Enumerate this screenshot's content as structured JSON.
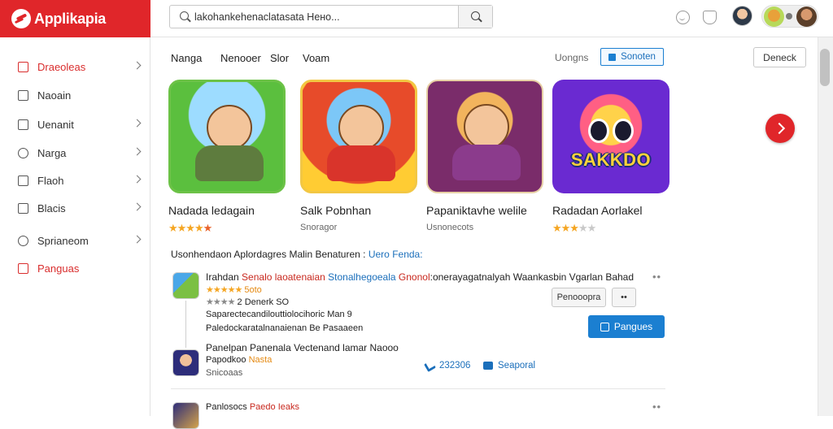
{
  "brand": {
    "name": "Applikapia"
  },
  "search": {
    "value": "lakohankehenaclatasata Hено..."
  },
  "sidebar": {
    "items": [
      {
        "label": "Draeoleas"
      },
      {
        "label": "Naoain"
      },
      {
        "label": "Uenanit"
      },
      {
        "label": "Narga"
      },
      {
        "label": "Flaoh"
      },
      {
        "label": "Blacis"
      },
      {
        "label": "Sprianeom"
      },
      {
        "label": "Panguas"
      }
    ]
  },
  "filters": {
    "tabs": [
      "Nanga",
      "Nenooer",
      "Slor",
      "Voam"
    ],
    "link": "Uongns",
    "highlight_button": "Sonoten",
    "right_button": "Deneck"
  },
  "cards": [
    {
      "title": "Nadada ledagain",
      "stars": "★★★★",
      "half": "★"
    },
    {
      "title": "Salk Pobnhan",
      "sub": "Snoragor"
    },
    {
      "title": "Papaniktavhe welile",
      "sub": "Usnonecots"
    },
    {
      "title": "Radadan Aorlakel",
      "stars": "★★★",
      "dim": "★★",
      "badge": "SAKKDO"
    }
  ],
  "section": {
    "title": "Usonhendaon Aplordagres Malin Benaturen :",
    "highlight": "Uero Fenda:"
  },
  "feed": {
    "post1": {
      "line1_name": "Irahdan",
      "line1_red": "Senalo laoatenaian",
      "line1_blue": "Stonalhegoeala",
      "line1_red2": "Gnonol",
      "line1_rest": ":onerayagatnalyah Waankasbin Vgarlan Bahad",
      "rating_stars": "★★★★★",
      "rating_value": "5oto",
      "meta_stars": "★★★★",
      "meta_text": "2  Denerk  SO",
      "line3": "Saparectecandilouttiolocihoric  Man  9",
      "line4": "Paledockaratalnanaienan  Be  Pasaaeen",
      "btn_secondary": "Penooopra",
      "btn_tertiary": "••",
      "btn_primary": "Pangues"
    },
    "post2": {
      "line1": "Panelpan  Panenala  Vectenand lamar  Naooo",
      "line2_name": "Papodkoo",
      "line2_orange": "Nasta",
      "line3": "Snicoaas",
      "like_count": "232306",
      "share_label": "Seaporal"
    },
    "post3": {
      "name": "Panlosocs",
      "highlight": "Paedo Ieaks"
    },
    "dots": "••"
  }
}
